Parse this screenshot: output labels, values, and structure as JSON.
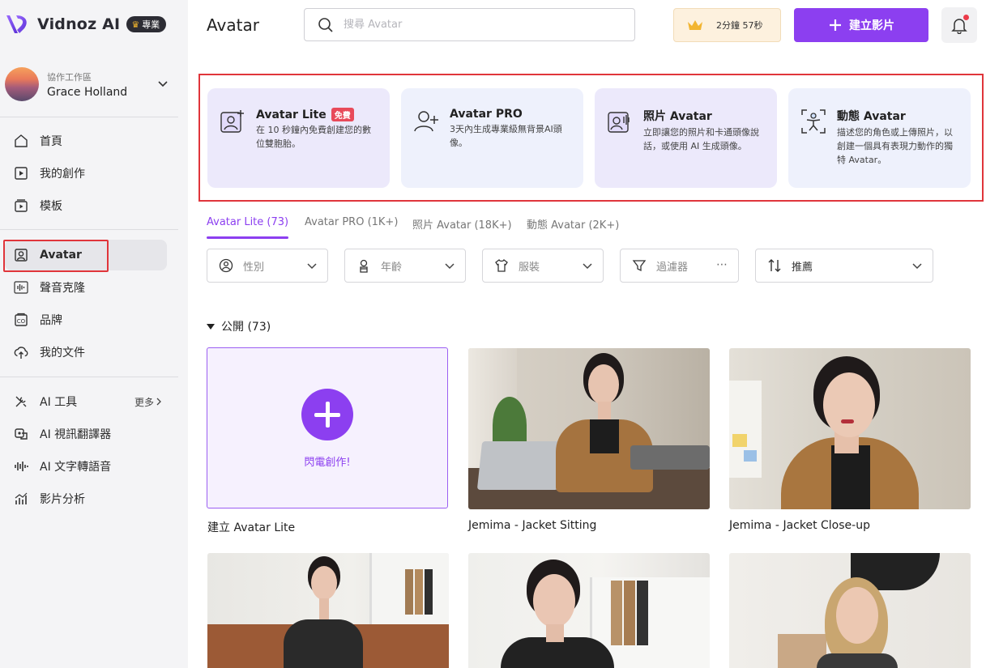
{
  "brand": {
    "name": "Vidnoz AI",
    "badge": "專業",
    "colors": {
      "accent": "#8c3ff0",
      "highlight": "#e0353b"
    }
  },
  "workspace": {
    "label": "協作工作區",
    "name": "Grace Holland"
  },
  "nav": {
    "home": "首頁",
    "creations": "我的創作",
    "templates": "模板",
    "avatar": "Avatar",
    "voice_clone": "聲音克隆",
    "brand": "品牌",
    "documents": "我的文件",
    "ai_tools": "AI 工具",
    "more": "更多",
    "video_translator": "AI 視訊翻譯器",
    "tts": "AI 文字轉語音",
    "video_analytics": "影片分析"
  },
  "header": {
    "title": "Avatar",
    "search_placeholder": "搜尋 Avatar",
    "credits": "2分鐘 57秒",
    "create_label": "建立影片"
  },
  "feature_cards": [
    {
      "title": "Avatar Lite",
      "badge": "免費",
      "desc": "在 10 秒鐘內免費創建您的數位雙胞胎。",
      "icon": "avatar-lite-icon"
    },
    {
      "title": "Avatar PRO",
      "badge": "",
      "desc": "3天內生成專業級無背景AI頭像。",
      "icon": "add-user-icon"
    },
    {
      "title": "照片 Avatar",
      "badge": "",
      "desc": "立即讓您的照片和卡通頭像說話，或使用 AI 生成頭像。",
      "icon": "talking-photo-icon"
    },
    {
      "title": "動態 Avatar",
      "badge": "",
      "desc": "描述您的角色或上傳照片，以創建一個具有表現力動作的獨特 Avatar。",
      "icon": "dynamic-avatar-icon"
    }
  ],
  "tabs": [
    "Avatar Lite (73)",
    "Avatar PRO (1K+)",
    "照片 Avatar (18K+)",
    "動態 Avatar (2K+)"
  ],
  "filters": {
    "gender": "性別",
    "age": "年齡",
    "outfit": "服裝",
    "filter": "過濾器",
    "sort": "推薦"
  },
  "section": {
    "title": "公開 (73)"
  },
  "grid": {
    "create_text": "閃電創作!",
    "create_caption": "建立 Avatar Lite",
    "items": [
      {
        "caption": "Jemima - Jacket Sitting"
      },
      {
        "caption": "Jemima - Jacket Close-up"
      }
    ]
  }
}
